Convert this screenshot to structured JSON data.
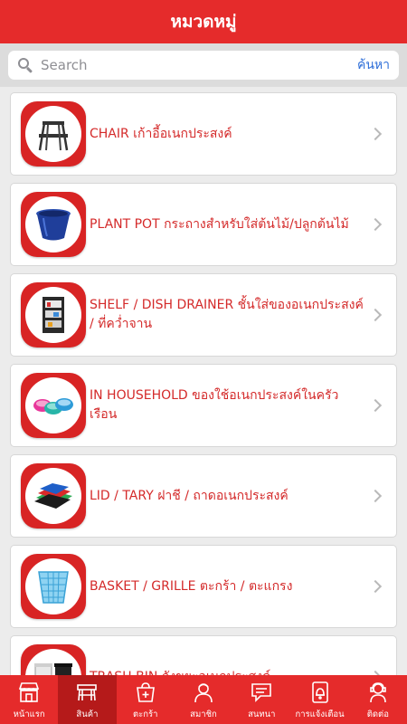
{
  "header": {
    "title": "หมวดหมู่"
  },
  "search": {
    "placeholder": "Search",
    "button_label": "ค้นหา"
  },
  "categories": [
    {
      "label": "CHAIR เก้าอี้อเนกประสงค์",
      "icon": "step-stool-icon"
    },
    {
      "label": "PLANT POT กระถางสำหรับใส่ต้นไม้/ปลูกต้นไม้",
      "icon": "plant-pot-icon"
    },
    {
      "label": "SHELF / DISH DRAINER ชั้นใส่ของอเนกประสงค์ / ที่คว่ำจาน",
      "icon": "shelf-icon"
    },
    {
      "label": "IN HOUSEHOLD ของใช้อเนกประสงค์ในครัวเรือน",
      "icon": "household-bowls-icon"
    },
    {
      "label": "LID / TARY ฝาชี / ถาดอเนกประสงค์",
      "icon": "tray-icon"
    },
    {
      "label": "BASKET / GRILLE ตะกร้า / ตะแกรง",
      "icon": "basket-icon"
    },
    {
      "label": "TRASH BIN ถังขยะอเนกประสงค์",
      "icon": "trash-bin-icon"
    }
  ],
  "tabs": [
    {
      "label": "หน้าแรก",
      "icon": "store-icon",
      "active": false
    },
    {
      "label": "สินค้า",
      "icon": "product-icon",
      "active": true
    },
    {
      "label": "ตะกร้า",
      "icon": "cart-icon",
      "active": false
    },
    {
      "label": "สมาชิก",
      "icon": "member-icon",
      "active": false
    },
    {
      "label": "สนทนา",
      "icon": "chat-icon",
      "active": false
    },
    {
      "label": "การแจ้งเตือน",
      "icon": "notification-icon",
      "active": false
    },
    {
      "label": "ติดต่อ",
      "icon": "contact-icon",
      "active": false
    }
  ],
  "colors": {
    "primary": "#e52b2b",
    "active_tab": "#b51a1a",
    "label_text": "#d42a2a",
    "search_button": "#2f6fd8"
  }
}
